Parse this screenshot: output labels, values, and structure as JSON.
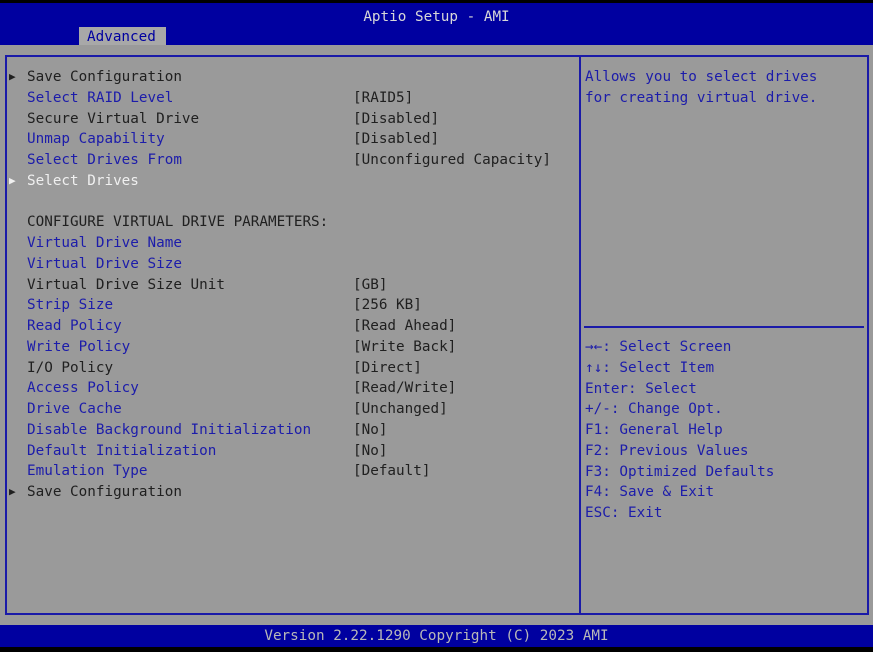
{
  "header": {
    "title": "Aptio Setup - AMI",
    "tab": "Advanced"
  },
  "items": [
    {
      "label": "Save Configuration",
      "value": "",
      "style": "blk",
      "arrow": true
    },
    {
      "label": "Select RAID Level",
      "value": "[RAID5]",
      "style": "blue"
    },
    {
      "label": "Secure Virtual Drive",
      "value": "[Disabled]",
      "style": "blk"
    },
    {
      "label": "Unmap Capability",
      "value": "[Disabled]",
      "style": "blue"
    },
    {
      "label": "Select Drives From",
      "value": "[Unconfigured Capacity]",
      "style": "blue"
    },
    {
      "label": "Select Drives",
      "value": "",
      "style": "wht",
      "arrow": true,
      "selected": true
    },
    {
      "label": "",
      "value": "",
      "style": "blk"
    },
    {
      "label": "CONFIGURE VIRTUAL DRIVE PARAMETERS:",
      "value": "",
      "style": "blk"
    },
    {
      "label": "Virtual Drive Name",
      "value": "",
      "style": "blue"
    },
    {
      "label": "Virtual Drive Size",
      "value": "",
      "style": "blue"
    },
    {
      "label": "Virtual Drive Size Unit",
      "value": "[GB]",
      "style": "blk"
    },
    {
      "label": "Strip Size",
      "value": "[256 KB]",
      "style": "blue"
    },
    {
      "label": "Read Policy",
      "value": "[Read Ahead]",
      "style": "blue"
    },
    {
      "label": "Write Policy",
      "value": "[Write Back]",
      "style": "blue"
    },
    {
      "label": "I/O Policy",
      "value": "[Direct]",
      "style": "blk"
    },
    {
      "label": "Access Policy",
      "value": "[Read/Write]",
      "style": "blue"
    },
    {
      "label": "Drive Cache",
      "value": "[Unchanged]",
      "style": "blue"
    },
    {
      "label": "Disable Background Initialization",
      "value": "[No]",
      "style": "blue"
    },
    {
      "label": "Default Initialization",
      "value": "[No]",
      "style": "blue"
    },
    {
      "label": "Emulation Type",
      "value": "[Default]",
      "style": "blue"
    },
    {
      "label": "Save Configuration",
      "value": "",
      "style": "blk",
      "arrow": true
    }
  ],
  "help": {
    "description": "Allows you to select drives\nfor creating virtual drive.",
    "keys": [
      "→←: Select Screen",
      "↑↓: Select Item",
      "Enter: Select",
      "+/-: Change Opt.",
      "F1: General Help",
      "F2: Previous Values",
      "F3: Optimized Defaults",
      "F4: Save & Exit",
      "ESC: Exit"
    ]
  },
  "footer": "Version 2.22.1290 Copyright (C) 2023 AMI",
  "colors": {
    "header": "#0000a0",
    "body": "#9a9a9a",
    "item": "#1c1caa",
    "selected": "#f0f0f0"
  }
}
